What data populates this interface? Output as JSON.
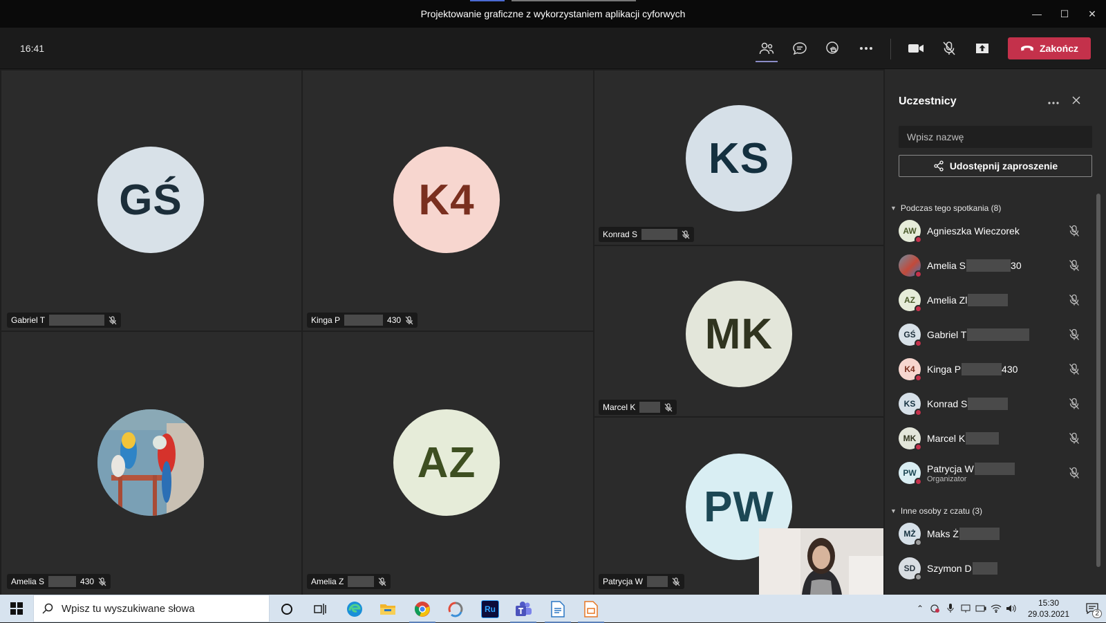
{
  "window": {
    "title": "Projektowanie graficzne z wykorzystaniem aplikacji cyforwych",
    "controls": [
      "minimize",
      "maximize",
      "close"
    ]
  },
  "toolbar": {
    "time": "16:41",
    "end_label": "Zakończ",
    "icons": [
      "people-icon",
      "chat-icon",
      "raise-hand-icon",
      "more-icon",
      "camera-icon",
      "mic-off-icon",
      "share-tray-icon",
      "phone-end-icon"
    ]
  },
  "tiles": [
    {
      "initials": "GŚ",
      "name": "Gabriel T",
      "bg": "#d8e1e8",
      "fg": "#1c2e3a"
    },
    {
      "initials": "K4",
      "name": "Kinga P",
      "suffix": "430",
      "bg": "#f7d6cf",
      "fg": "#7a2f1f"
    },
    {
      "initials": "KS",
      "name": "Konrad S",
      "bg": "#d6e0e8",
      "fg": "#14303f"
    },
    {
      "initials": "MK",
      "name": "Marcel K",
      "bg": "#e3e6da",
      "fg": "#30341f"
    },
    {
      "initials": "",
      "name": "Amelia S",
      "suffix": "430",
      "photo": true
    },
    {
      "initials": "AZ",
      "name": "Amelia Z",
      "bg": "#e6ecd9",
      "fg": "#3e4f21"
    },
    {
      "initials": "PW",
      "name": "Patrycja W",
      "bg": "#d9eef3",
      "fg": "#1c4754"
    }
  ],
  "participants_pane": {
    "title": "Uczestnicy",
    "search_placeholder": "Wpisz nazwę",
    "invite_label": "Udostępnij zaproszenie",
    "in_meeting_label": "Podczas tego spotkania (8)",
    "others_label": "Inne osoby z czatu (3)",
    "in_meeting": [
      {
        "initials": "AW",
        "name": "Agnieszka Wieczorek",
        "bg": "#e6ecd9",
        "fg": "#4a5a2a"
      },
      {
        "initials": "",
        "name": "Amelia S",
        "suffix": "30",
        "photo": true
      },
      {
        "initials": "AZ",
        "name": "Amelia Zl",
        "bg": "#e6ecd9",
        "fg": "#4a5a2a"
      },
      {
        "initials": "GŚ",
        "name": "Gabriel T",
        "bg": "#d8e1e8",
        "fg": "#1c2e3a"
      },
      {
        "initials": "K4",
        "name": "Kinga P",
        "suffix": "430",
        "bg": "#f7d6cf",
        "fg": "#7a2f1f"
      },
      {
        "initials": "KS",
        "name": "Konrad S",
        "bg": "#d6e0e8",
        "fg": "#14303f"
      },
      {
        "initials": "MK",
        "name": "Marcel K",
        "bg": "#e3e6da",
        "fg": "#30341f"
      },
      {
        "initials": "PW",
        "name": "Patrycja W",
        "sub": "Organizator",
        "bg": "#d9eef3",
        "fg": "#1c4754"
      }
    ],
    "others": [
      {
        "initials": "MŻ",
        "name": "Maks Ż",
        "bg": "#d6e0e8",
        "fg": "#14303f"
      },
      {
        "initials": "SD",
        "name": "Szymon D",
        "bg": "#d8dde2",
        "fg": "#2a3640"
      }
    ]
  },
  "taskbar": {
    "search_placeholder": "Wpisz tu wyszukiwane słowa",
    "apps": [
      "cortana-icon",
      "task-view-icon",
      "edge-icon",
      "explorer-icon",
      "chrome-icon",
      "app-icon",
      "rush-icon",
      "teams-icon",
      "docs-icon",
      "slides-icon"
    ],
    "rush_label": "Ru",
    "time": "15:30",
    "date": "29.03.2021",
    "notification_count": "2"
  }
}
